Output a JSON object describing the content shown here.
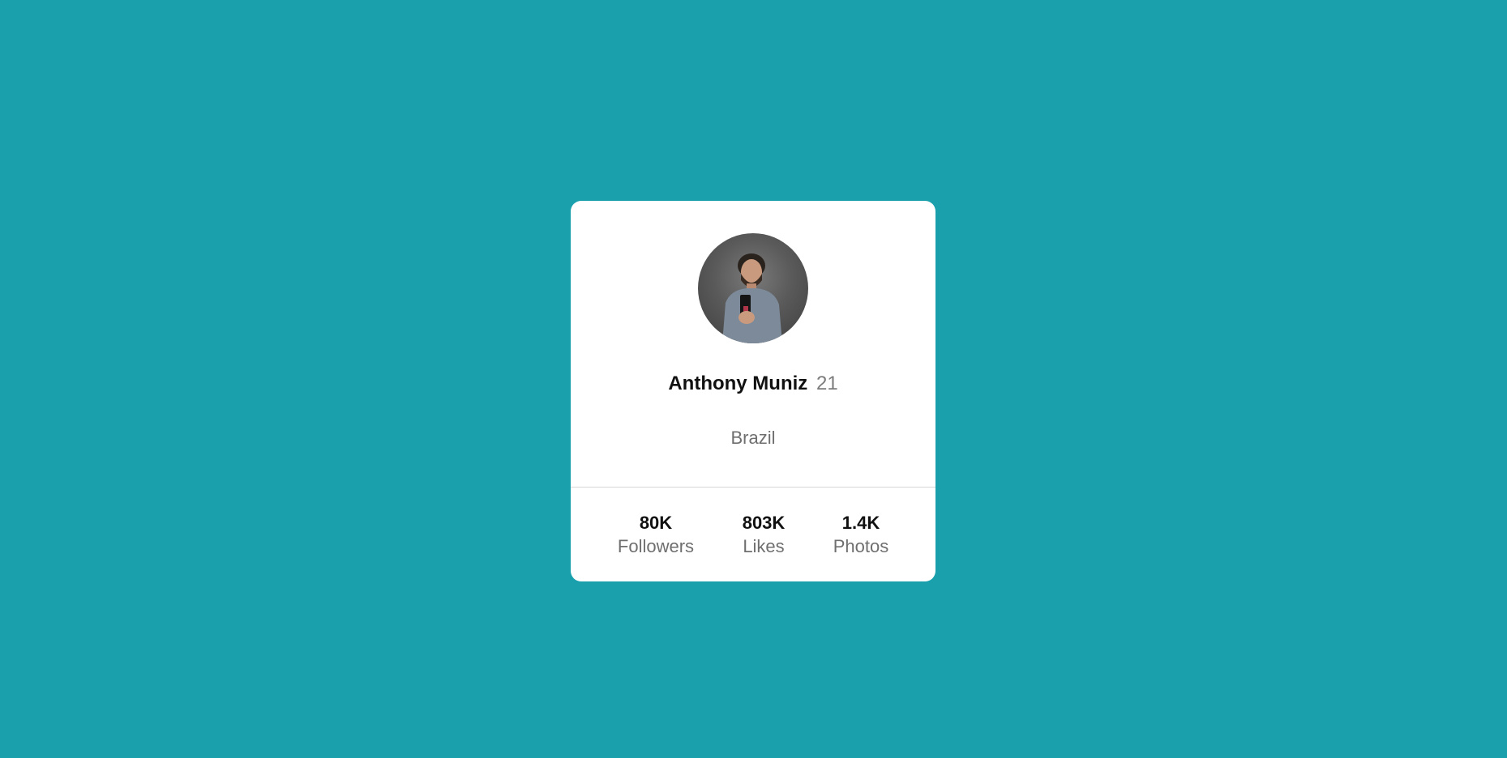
{
  "background_color": "#19a0ac",
  "profile": {
    "avatar_icon": "profile-photo",
    "name": "Anthony Muniz",
    "age": "21",
    "location": "Brazil"
  },
  "stats": [
    {
      "value": "80K",
      "label": "Followers"
    },
    {
      "value": "803K",
      "label": "Likes"
    },
    {
      "value": "1.4K",
      "label": "Photos"
    }
  ]
}
